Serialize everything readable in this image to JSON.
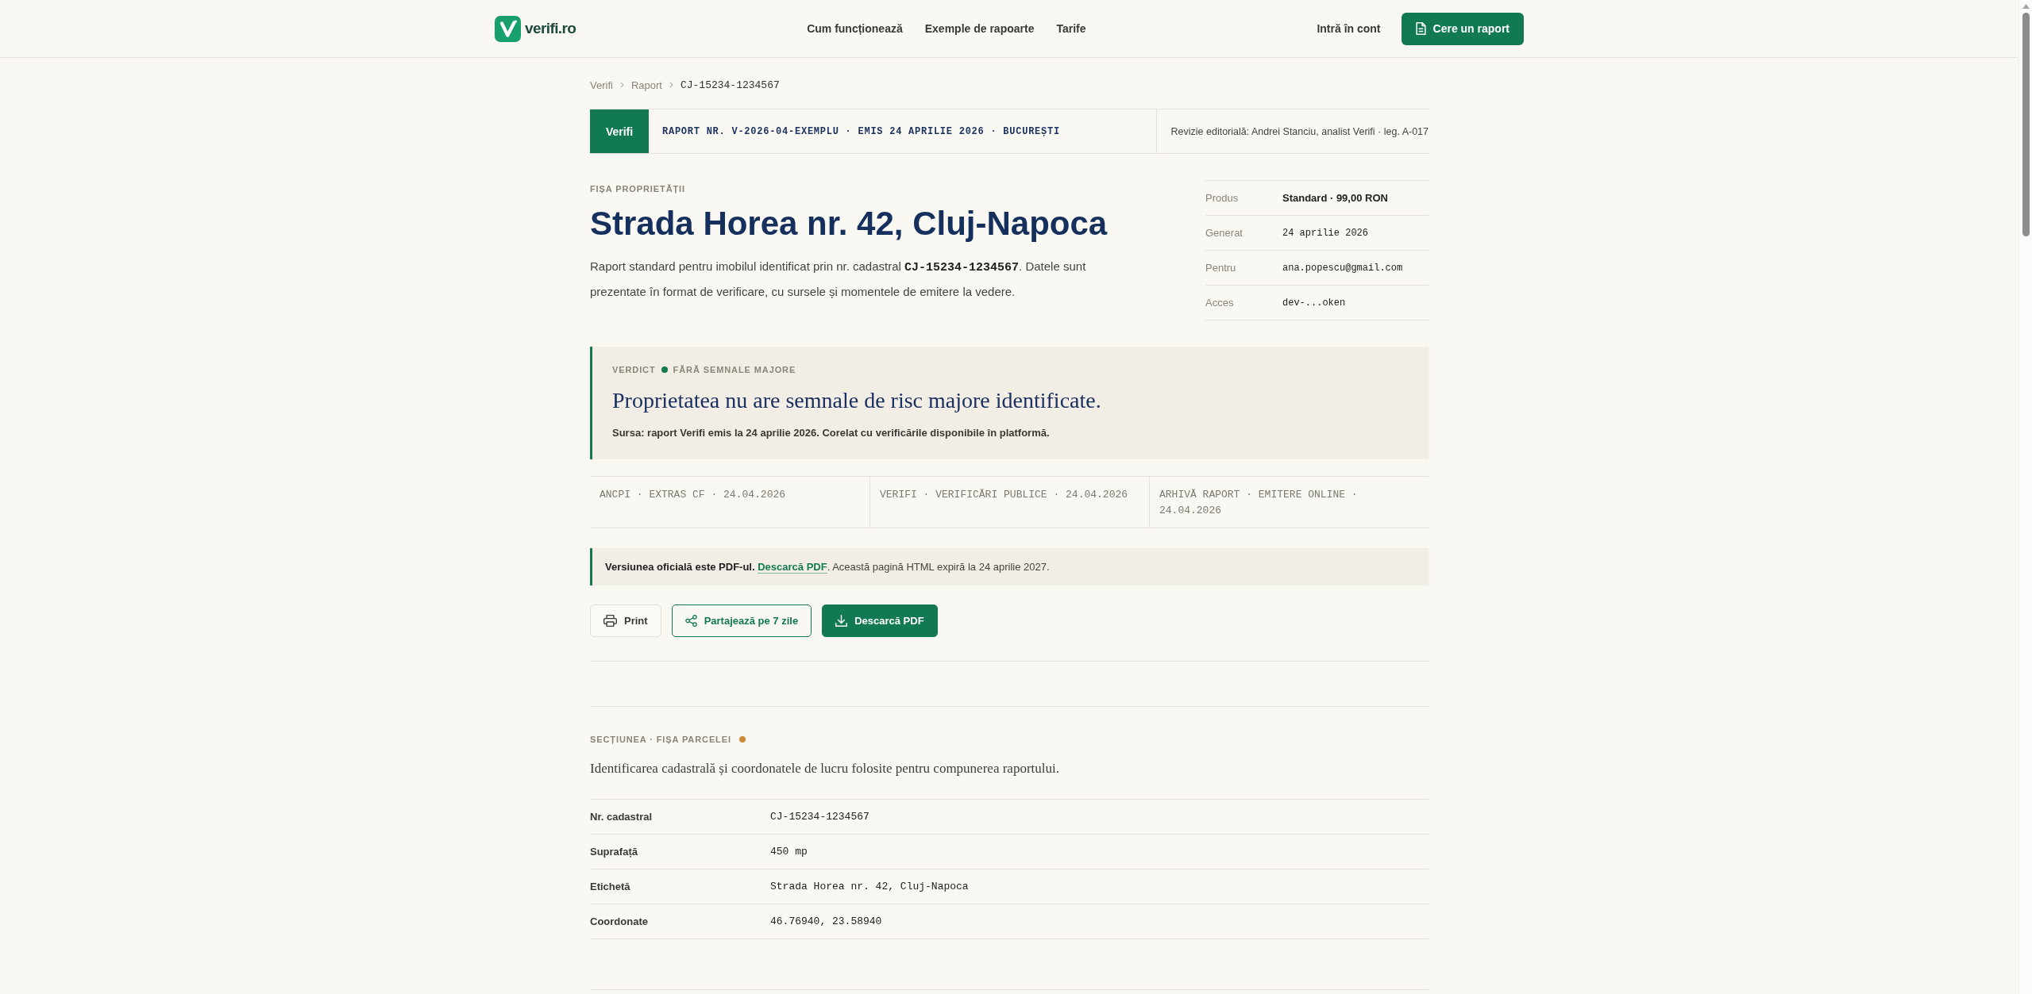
{
  "header": {
    "logo_text": "verifi.ro",
    "nav": [
      "Cum funcționează",
      "Exemple de rapoarte",
      "Tarife"
    ],
    "login": "Intră în cont",
    "cta": "Cere un raport"
  },
  "breadcrumb": [
    {
      "label": "Verifi",
      "kind": "link"
    },
    {
      "label": "Raport",
      "kind": "link"
    },
    {
      "label": "CJ-15234-1234567",
      "kind": "current"
    }
  ],
  "report_bar": {
    "badge": "Verifi",
    "reference": "RAPORT NR. V-2026-04-EXEMPLU · EMIS 24 APRILIE 2026 · BUCUREȘTI",
    "review": "Revizie editorială: Andrei Stanciu, analist Verifi · leg. A-017"
  },
  "property": {
    "eyebrow": "FIȘA PROPRIETĂȚII",
    "title": "Strada Horea nr. 42, Cluj-Napoca",
    "intro": [
      {
        "kind": "text",
        "text": "Raport standard pentru imobilul identificat prin nr. cadastral"
      },
      {
        "kind": "code",
        "text": "CJ-15234-1234567"
      },
      {
        "kind": "text",
        "text": ". Datele sunt prezentate în format de verificare, cu sursele și momentele de emitere la vedere."
      }
    ],
    "meta": [
      {
        "label": "Produs",
        "value": "Standard · 99,00 RON",
        "kind": "text"
      },
      {
        "label": "Generat",
        "value": "24 aprilie 2026",
        "kind": "mono"
      },
      {
        "label": "Pentru",
        "value": "ana.popescu@gmail.com",
        "kind": "mono"
      },
      {
        "label": "Acces",
        "value": "dev-...oken",
        "kind": "mono"
      }
    ]
  },
  "verdict": {
    "label": "VERDICT",
    "status": "FĂRĂ SEMNALE MAJORE",
    "heading": "Proprietatea nu are semnale de risc majore identificate.",
    "source": "Sursa: raport Verifi emis la 24 aprilie 2026. Corelat cu verificările disponibile în platformă."
  },
  "sources": [
    "ANCPI · EXTRAS CF · 24.04.2026",
    "VERIFI · VERIFICĂRI PUBLICE · 24.04.2026",
    "ARHIVĂ RAPORT · EMITERE ONLINE · 24.04.2026"
  ],
  "notice": {
    "lead": "Versiunea oficială este PDF-ul.",
    "link": "Descarcă PDF",
    "rest": ". Această pagină HTML expiră la 24 aprilie 2027."
  },
  "actions": [
    {
      "kind": "print",
      "label": "Print"
    },
    {
      "kind": "share",
      "label": "Partajează pe 7 zile"
    },
    {
      "kind": "download",
      "label": "Descarcă PDF"
    }
  ],
  "parcel_section": {
    "eyebrow": "SECȚIUNEA · FIȘA PARCELEI",
    "description": "Identificarea cadastrală și coordonatele de lucru folosite pentru compunerea raportului.",
    "rows": [
      {
        "label": "Nr. cadastral",
        "value": "CJ-15234-1234567"
      },
      {
        "label": "Suprafață",
        "value": "450 mp"
      },
      {
        "label": "Etichetă",
        "value": "Strada Horea nr. 42, Cluj-Napoca"
      },
      {
        "label": "Coordonate",
        "value": "46.76940, 23.58940"
      }
    ]
  }
}
